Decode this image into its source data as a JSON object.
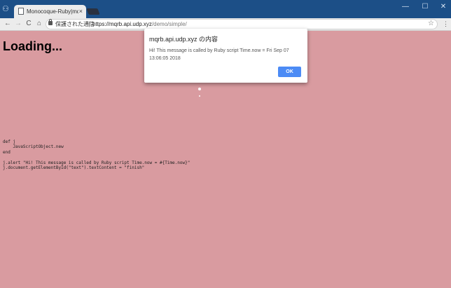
{
  "browser": {
    "tab_title": "Monocoque-Ruby|mqrb",
    "tab_close": "×",
    "secure_label": "保護された通信",
    "url_base": "https://mqrb.api.udp.xyz",
    "url_path": "/demo/simple/",
    "window_controls": {
      "minimize": "—",
      "maximize": "☐",
      "close": "✕"
    },
    "nav": {
      "back": "←",
      "forward": "→",
      "reload": "C",
      "home": "⌂"
    },
    "bookmark_star": "☆",
    "menu": "⋮"
  },
  "page": {
    "heading": "Loading...",
    "code": "def j\n    JavaScriptObject.new\nend\n\nj.alert \"Hi! This message is called by Ruby script Time.now = #{Time.now}\"\nj.document.getElementById(\"text\").textContent = \"finish\""
  },
  "dialog": {
    "title": "mqrb.api.udp.xyz の内容",
    "message": "Hi! This message is called by Ruby script Time.now = Fri Sep 07 13:06:05 2018",
    "ok_label": "OK"
  },
  "colors": {
    "page_background": "#d99ba0",
    "titlebar": "#1c4f87",
    "ok_button": "#4c8bf5"
  }
}
